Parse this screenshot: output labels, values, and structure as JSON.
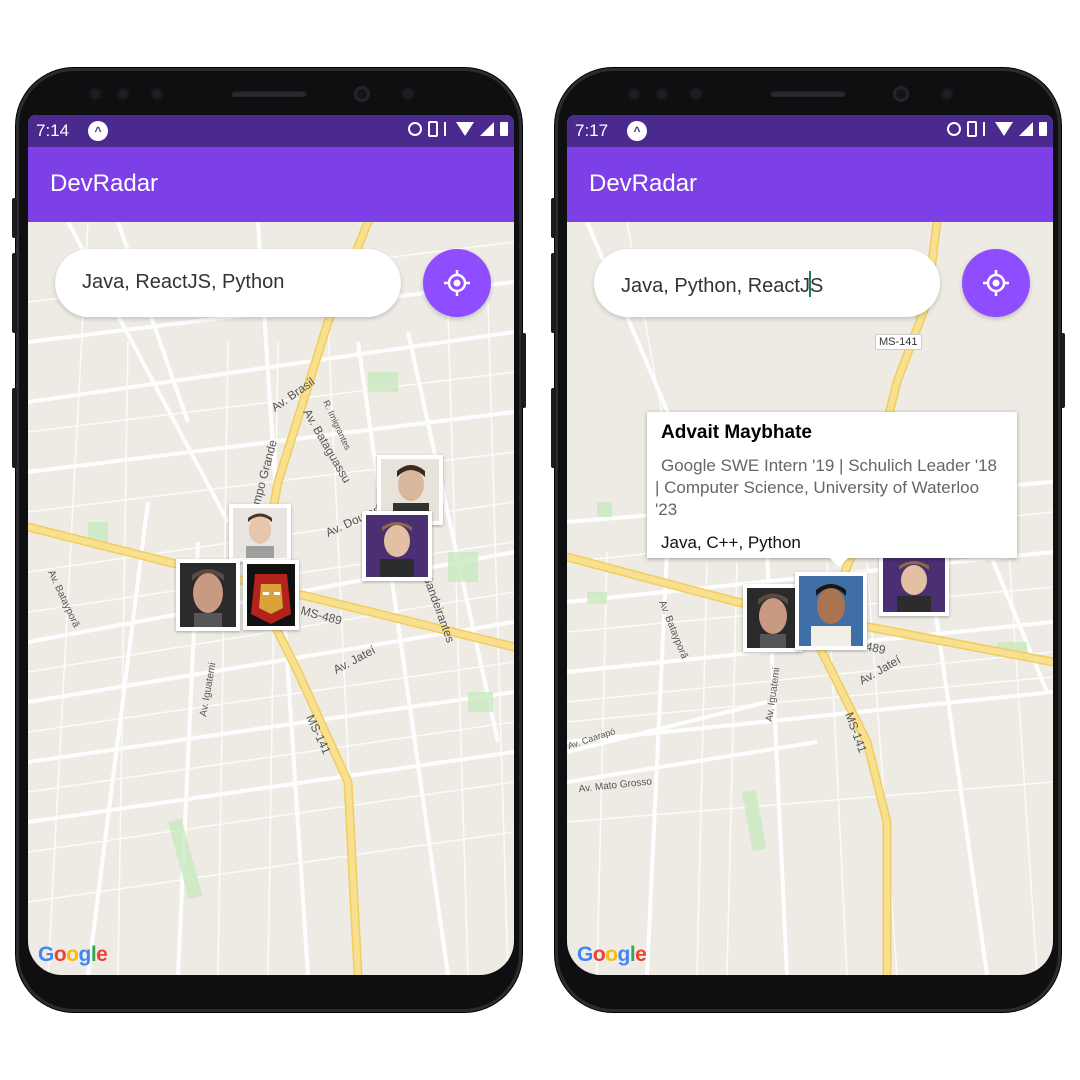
{
  "left_screen": {
    "status_time": "7:14",
    "app_title": "DevRadar",
    "search_value": "Java, ReactJS, Python",
    "road_labels": [
      "Av. Brasil",
      "Av. Bataguassu",
      "R. Imigrantes",
      "ampo Grande",
      "Av. Dourados",
      "Bandeirantes",
      "MS-489",
      "Av. Jateí",
      "Av. Iguatemi",
      "MS-141",
      "Av. Batayporã"
    ],
    "google_logo": "Google"
  },
  "right_screen": {
    "status_time": "7:17",
    "app_title": "DevRadar",
    "search_value_before_caret": "Java, Python, ReactJ",
    "search_value_after_caret": "S",
    "route_badge": "MS-141",
    "road_labels": [
      "Av. Batayporã",
      "Av. Iguatemi",
      "MS-141",
      "Av. Jateí",
      "Av. Caarapó",
      "Av. Mato Grosso",
      "489"
    ],
    "callout": {
      "name": "Advait Maybhate",
      "bio": "Google SWE Intern '19 | Schulich Leader '18 | Computer Science, University of Waterloo '23",
      "techs": "Java, C++, Python"
    },
    "google_logo": "Google"
  },
  "colors": {
    "status_bar": "#4b2a8f",
    "app_bar": "#7d40e7",
    "gps_button": "#8e4dff",
    "map_bg": "#eeebe5",
    "highway": "#f7dc7c"
  },
  "icons": [
    "android-notification-icon",
    "alarm-icon",
    "vibrate-icon",
    "data-icon",
    "wifi-icon",
    "signal-icon",
    "battery-icon",
    "my-location-icon"
  ]
}
